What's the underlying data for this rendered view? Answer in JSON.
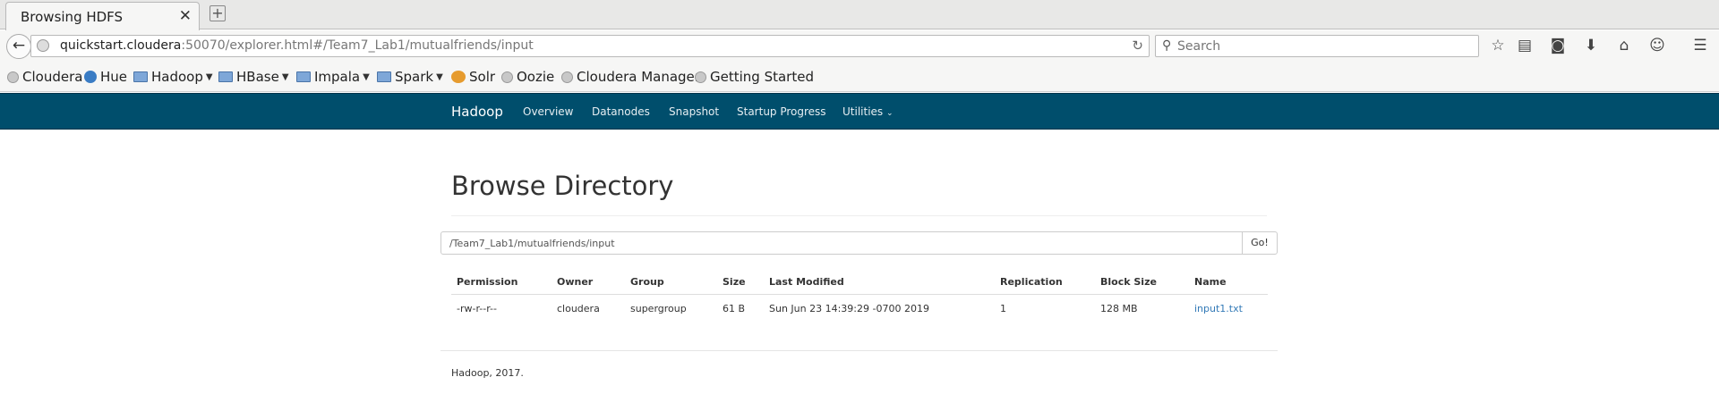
{
  "browser": {
    "tab_title": "Browsing HDFS",
    "tab_close": "✕",
    "new_tab": "+",
    "url_host": "quickstart.cloudera",
    "url_rest": ":50070/explorer.html#/Team7_Lab1/mutualfriends/input",
    "search_placeholder": "Search"
  },
  "bookmarks": [
    {
      "label": "Cloudera",
      "icon": "globe-icon"
    },
    {
      "label": "Hue",
      "icon": "hue-icon"
    },
    {
      "label": "Hadoop",
      "icon": "folder-icon"
    },
    {
      "label": "HBase",
      "icon": "folder-icon"
    },
    {
      "label": "Impala",
      "icon": "folder-icon"
    },
    {
      "label": "Spark",
      "icon": "folder-icon"
    },
    {
      "label": "Solr",
      "icon": "solr-icon"
    },
    {
      "label": "Oozie",
      "icon": "globe-icon"
    },
    {
      "label": "Cloudera Manager",
      "icon": "globe-icon"
    },
    {
      "label": "Getting Started",
      "icon": "globe-icon"
    }
  ],
  "hadoop_nav": {
    "brand": "Hadoop",
    "links": [
      "Overview",
      "Datanodes",
      "Snapshot",
      "Startup Progress",
      "Utilities"
    ],
    "utilities_caret": "⌄"
  },
  "main": {
    "title": "Browse Directory",
    "path_value": "/Team7_Lab1/mutualfriends/input",
    "go_label": "Go!",
    "columns": [
      "Permission",
      "Owner",
      "Group",
      "Size",
      "Last Modified",
      "Replication",
      "Block Size",
      "Name"
    ],
    "rows": [
      [
        "-rw-r--r--",
        "cloudera",
        "supergroup",
        "61 B",
        "Sun Jun 23 14:39:29 -0700 2019",
        "1",
        "128 MB",
        "input1.txt"
      ]
    ],
    "footer": "Hadoop, 2017."
  },
  "colors": {
    "navbar_bg": "#004e6c",
    "link": "#337ab7"
  }
}
